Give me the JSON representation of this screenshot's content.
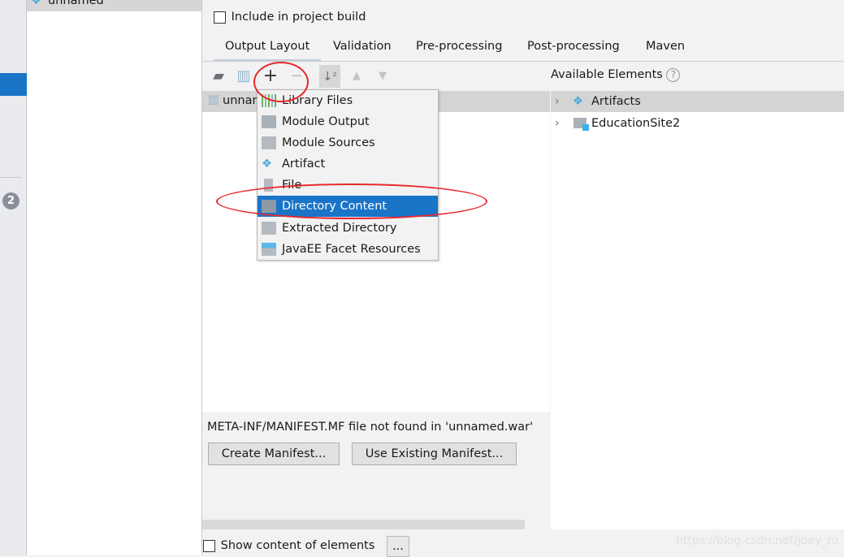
{
  "sidebar": {
    "badge": "2"
  },
  "artifact_list": {
    "items": [
      {
        "label": "unnamed"
      }
    ]
  },
  "include_in_build": {
    "label": "Include in project build",
    "checked": false
  },
  "tabs": [
    {
      "label": "Output Layout",
      "active": true
    },
    {
      "label": "Validation"
    },
    {
      "label": "Pre-processing"
    },
    {
      "label": "Post-processing"
    },
    {
      "label": "Maven"
    }
  ],
  "toolbar": {
    "icons": [
      "new-folder-icon",
      "archive-icon",
      "add-icon",
      "remove-icon",
      "sort-icon",
      "move-up-icon",
      "move-down-icon"
    ]
  },
  "output_tree": {
    "root": "unnamed"
  },
  "add_menu": {
    "items": [
      {
        "label": "Library Files",
        "icon": "library-icon"
      },
      {
        "label": "Module Output",
        "icon": "module-output-icon"
      },
      {
        "label": "Module Sources",
        "icon": "module-sources-icon"
      },
      {
        "label": "Artifact",
        "icon": "artifact-icon"
      },
      {
        "label": "File",
        "icon": "file-icon"
      },
      {
        "label": "Directory Content",
        "icon": "folder-icon",
        "highlighted": true
      },
      {
        "label": "Extracted Directory",
        "icon": "extracted-directory-icon"
      },
      {
        "label": "JavaEE Facet Resources",
        "icon": "javaee-icon"
      }
    ]
  },
  "available": {
    "title": "Available Elements",
    "items": [
      {
        "label": "Artifacts"
      },
      {
        "label": "EducationSite2"
      }
    ]
  },
  "manifest": {
    "message": "META-INF/MANIFEST.MF file not found in 'unnamed.war'",
    "create": "Create Manifest...",
    "use_existing": "Use Existing Manifest..."
  },
  "show_content": {
    "label": "Show content of elements",
    "checked": false,
    "more": "..."
  },
  "watermark": "https://blog.csdn.net/joey_ro",
  "colors": {
    "accent": "#1a74c8",
    "annotation": "#e8282d"
  }
}
